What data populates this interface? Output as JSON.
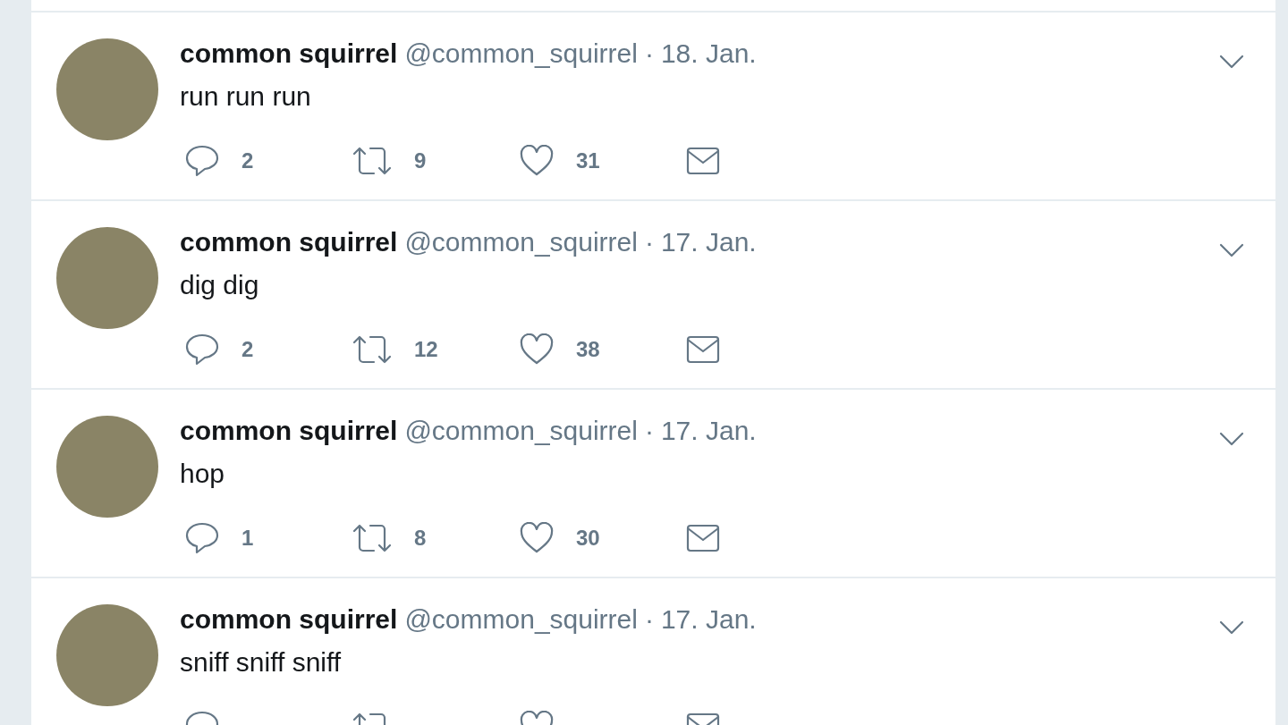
{
  "tweets": [
    {
      "name": "common squirrel",
      "handle": "@common_squirrel",
      "separator": "·",
      "date": "18. Jan.",
      "text": "run run run",
      "replies": "2",
      "retweets": "9",
      "likes": "31"
    },
    {
      "name": "common squirrel",
      "handle": "@common_squirrel",
      "separator": "·",
      "date": "17. Jan.",
      "text": "dig dig",
      "replies": "2",
      "retweets": "12",
      "likes": "38"
    },
    {
      "name": "common squirrel",
      "handle": "@common_squirrel",
      "separator": "·",
      "date": "17. Jan.",
      "text": "hop",
      "replies": "1",
      "retweets": "8",
      "likes": "30"
    },
    {
      "name": "common squirrel",
      "handle": "@common_squirrel",
      "separator": "·",
      "date": "17. Jan.",
      "text": "sniff sniff sniff"
    }
  ]
}
